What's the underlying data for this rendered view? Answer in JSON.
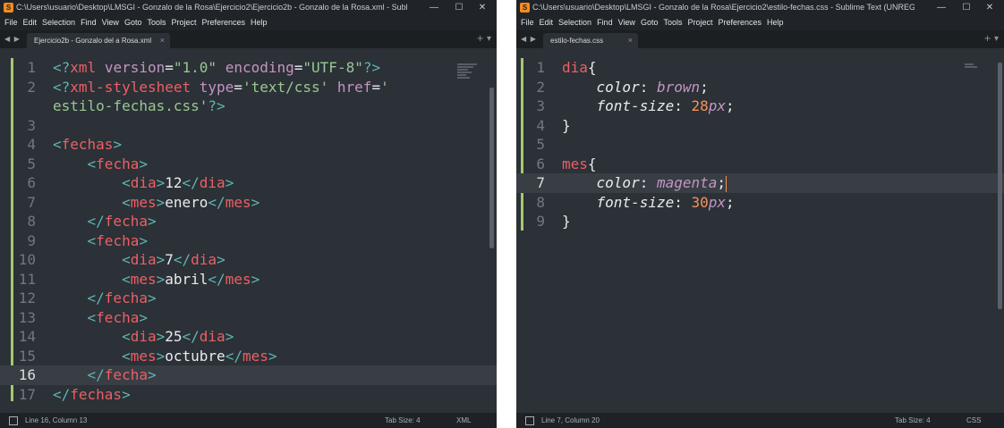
{
  "left": {
    "title": "C:\\Users\\usuario\\Desktop\\LMSGI - Gonzalo de la Rosa\\Ejercicio2\\Ejercicio2b - Gonzalo de la Rosa.xml - Sublime Text (...",
    "tab_label": "Ejercicio2b - Gonzalo del a Rosa.xml",
    "status_position": "Line 16, Column 13",
    "status_tab_size": "Tab Size: 4",
    "status_syntax": "XML"
  },
  "right": {
    "title": "C:\\Users\\usuario\\Desktop\\LMSGI - Gonzalo de la Rosa\\Ejercicio2\\estilo-fechas.css - Sublime Text (UNREGISTERED)",
    "tab_label": "estilo-fechas.css",
    "status_position": "Line 7, Column 20",
    "status_tab_size": "Tab Size: 4",
    "status_syntax": "CSS"
  },
  "menu": [
    "File",
    "Edit",
    "Selection",
    "Find",
    "View",
    "Goto",
    "Tools",
    "Project",
    "Preferences",
    "Help"
  ],
  "window_controls": {
    "minimize": "—",
    "maximize": "☐",
    "close": "✕"
  },
  "tab_close": "×",
  "tab_arrows": "◀ ▶",
  "tab_new": "+ ▾",
  "xml_lines": [
    {
      "n": "1",
      "tokens": [
        [
          "pun",
          "<?"
        ],
        [
          "tag",
          "xml"
        ],
        [
          "t",
          " "
        ],
        [
          "attr",
          "version"
        ],
        [
          "t",
          "="
        ],
        [
          "str",
          "\"1.0\""
        ],
        [
          "t",
          " "
        ],
        [
          "attr",
          "encoding"
        ],
        [
          "t",
          "="
        ],
        [
          "str",
          "\"UTF-8\""
        ],
        [
          "pun",
          "?>"
        ]
      ]
    },
    {
      "n": "2",
      "tokens": [
        [
          "pun",
          "<?"
        ],
        [
          "tag",
          "xml-stylesheet"
        ],
        [
          "t",
          " "
        ],
        [
          "attr",
          "type"
        ],
        [
          "t",
          "="
        ],
        [
          "str",
          "'text/css'"
        ],
        [
          "t",
          " "
        ],
        [
          "attr",
          "href"
        ],
        [
          "t",
          "="
        ],
        [
          "str",
          "'"
        ]
      ]
    },
    {
      "n": "",
      "tokens": [
        [
          "str",
          "estilo-fechas.css'"
        ],
        [
          "pun",
          "?>"
        ]
      ]
    },
    {
      "n": "3",
      "tokens": []
    },
    {
      "n": "4",
      "tokens": [
        [
          "pun",
          "<"
        ],
        [
          "tag",
          "fechas"
        ],
        [
          "pun",
          ">"
        ]
      ]
    },
    {
      "n": "5",
      "tokens": [
        [
          "t",
          "    "
        ],
        [
          "pun",
          "<"
        ],
        [
          "tag",
          "fecha"
        ],
        [
          "pun",
          ">"
        ]
      ]
    },
    {
      "n": "6",
      "tokens": [
        [
          "t",
          "        "
        ],
        [
          "pun",
          "<"
        ],
        [
          "tag",
          "dia"
        ],
        [
          "pun",
          ">"
        ],
        [
          "t",
          "12"
        ],
        [
          "pun",
          "</"
        ],
        [
          "tag",
          "dia"
        ],
        [
          "pun",
          ">"
        ]
      ]
    },
    {
      "n": "7",
      "tokens": [
        [
          "t",
          "        "
        ],
        [
          "pun",
          "<"
        ],
        [
          "tag",
          "mes"
        ],
        [
          "pun",
          ">"
        ],
        [
          "t",
          "enero"
        ],
        [
          "pun",
          "</"
        ],
        [
          "tag",
          "mes"
        ],
        [
          "pun",
          ">"
        ]
      ]
    },
    {
      "n": "8",
      "tokens": [
        [
          "t",
          "    "
        ],
        [
          "pun",
          "</"
        ],
        [
          "tag",
          "fecha"
        ],
        [
          "pun",
          ">"
        ]
      ]
    },
    {
      "n": "9",
      "tokens": [
        [
          "t",
          "    "
        ],
        [
          "pun",
          "<"
        ],
        [
          "tag",
          "fecha"
        ],
        [
          "pun",
          ">"
        ]
      ]
    },
    {
      "n": "10",
      "tokens": [
        [
          "t",
          "        "
        ],
        [
          "pun",
          "<"
        ],
        [
          "tag",
          "dia"
        ],
        [
          "pun",
          ">"
        ],
        [
          "t",
          "7"
        ],
        [
          "pun",
          "</"
        ],
        [
          "tag",
          "dia"
        ],
        [
          "pun",
          ">"
        ]
      ]
    },
    {
      "n": "11",
      "tokens": [
        [
          "t",
          "        "
        ],
        [
          "pun",
          "<"
        ],
        [
          "tag",
          "mes"
        ],
        [
          "pun",
          ">"
        ],
        [
          "t",
          "abril"
        ],
        [
          "pun",
          "</"
        ],
        [
          "tag",
          "mes"
        ],
        [
          "pun",
          ">"
        ]
      ]
    },
    {
      "n": "12",
      "tokens": [
        [
          "t",
          "    "
        ],
        [
          "pun",
          "</"
        ],
        [
          "tag",
          "fecha"
        ],
        [
          "pun",
          ">"
        ]
      ]
    },
    {
      "n": "13",
      "tokens": [
        [
          "t",
          "    "
        ],
        [
          "pun",
          "<"
        ],
        [
          "tag",
          "fecha"
        ],
        [
          "pun",
          ">"
        ]
      ]
    },
    {
      "n": "14",
      "tokens": [
        [
          "t",
          "        "
        ],
        [
          "pun",
          "<"
        ],
        [
          "tag",
          "dia"
        ],
        [
          "pun",
          ">"
        ],
        [
          "t",
          "25"
        ],
        [
          "pun",
          "</"
        ],
        [
          "tag",
          "dia"
        ],
        [
          "pun",
          ">"
        ]
      ]
    },
    {
      "n": "15",
      "tokens": [
        [
          "t",
          "        "
        ],
        [
          "pun",
          "<"
        ],
        [
          "tag",
          "mes"
        ],
        [
          "pun",
          ">"
        ],
        [
          "t",
          "octubre"
        ],
        [
          "pun",
          "</"
        ],
        [
          "tag",
          "mes"
        ],
        [
          "pun",
          ">"
        ]
      ]
    },
    {
      "n": "16",
      "current": true,
      "tokens": [
        [
          "t",
          "    "
        ],
        [
          "pun",
          "</"
        ],
        [
          "tag",
          "fecha"
        ],
        [
          "pun",
          ">"
        ]
      ]
    },
    {
      "n": "17",
      "tokens": [
        [
          "pun",
          "</"
        ],
        [
          "tag",
          "fechas"
        ],
        [
          "pun",
          ">"
        ]
      ]
    }
  ],
  "css_lines": [
    {
      "n": "1",
      "tokens": [
        [
          "sel",
          "dia"
        ],
        [
          "t",
          "{"
        ]
      ]
    },
    {
      "n": "2",
      "tokens": [
        [
          "t",
          "    "
        ],
        [
          "prop",
          "color"
        ],
        [
          "t",
          ": "
        ],
        [
          "val",
          "brown"
        ],
        [
          "t",
          ";"
        ]
      ]
    },
    {
      "n": "3",
      "tokens": [
        [
          "t",
          "    "
        ],
        [
          "prop",
          "font-size"
        ],
        [
          "t",
          ": "
        ],
        [
          "num",
          "28"
        ],
        [
          "unit",
          "px"
        ],
        [
          "t",
          ";"
        ]
      ]
    },
    {
      "n": "4",
      "tokens": [
        [
          "t",
          "}"
        ]
      ]
    },
    {
      "n": "5",
      "tokens": []
    },
    {
      "n": "6",
      "tokens": [
        [
          "sel",
          "mes"
        ],
        [
          "t",
          "{"
        ]
      ]
    },
    {
      "n": "7",
      "current": true,
      "cursor": true,
      "tokens": [
        [
          "t",
          "    "
        ],
        [
          "prop",
          "color"
        ],
        [
          "t",
          ": "
        ],
        [
          "val",
          "magenta"
        ],
        [
          "t",
          ";"
        ]
      ]
    },
    {
      "n": "8",
      "tokens": [
        [
          "t",
          "    "
        ],
        [
          "prop",
          "font-size"
        ],
        [
          "t",
          ": "
        ],
        [
          "num",
          "30"
        ],
        [
          "unit",
          "px"
        ],
        [
          "t",
          ";"
        ]
      ]
    },
    {
      "n": "9",
      "tokens": [
        [
          "t",
          "}"
        ]
      ]
    }
  ],
  "colors": {
    "accent": "#f68b1f",
    "background": "#2b3136",
    "tag": "#ec5f67",
    "string": "#99c794",
    "attribute": "#c594c5",
    "number": "#f99157"
  }
}
